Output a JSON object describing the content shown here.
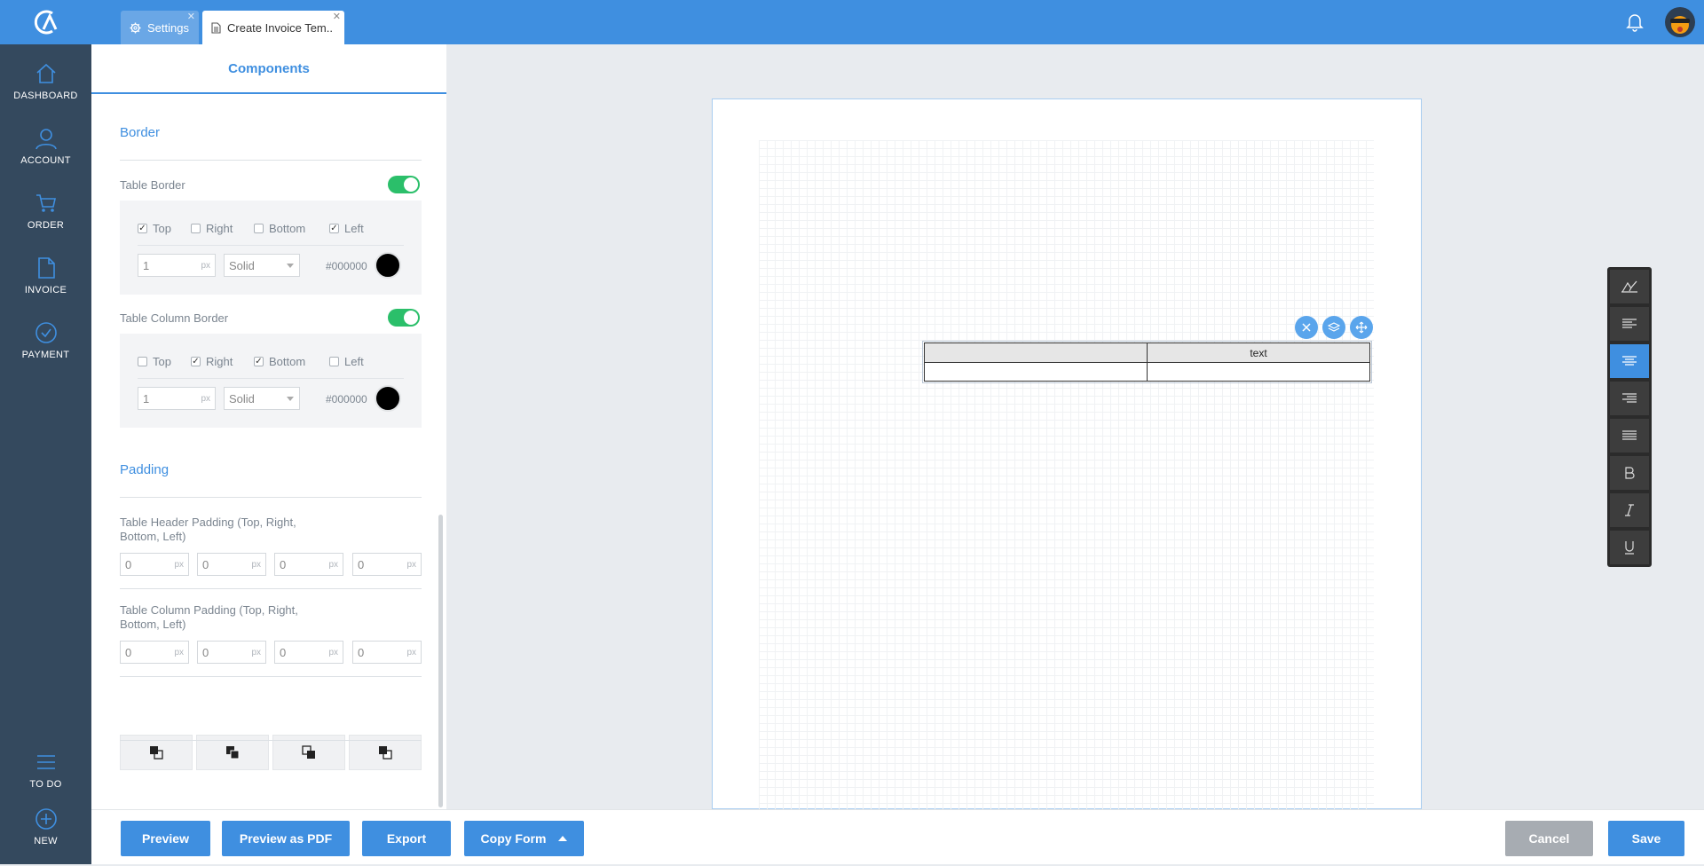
{
  "tabs": [
    {
      "label": "Settings",
      "icon": "gear-icon"
    },
    {
      "label": "Create Invoice Tem..",
      "icon": "document-icon"
    }
  ],
  "sidebar": {
    "items": [
      {
        "label": "DASHBOARD",
        "icon": "home-icon"
      },
      {
        "label": "ACCOUNT",
        "icon": "user-icon"
      },
      {
        "label": "ORDER",
        "icon": "cart-icon"
      },
      {
        "label": "INVOICE",
        "icon": "file-icon"
      },
      {
        "label": "PAYMENT",
        "icon": "check-circle-icon"
      }
    ],
    "bottom_items": [
      {
        "label": "TO DO",
        "icon": "list-icon"
      },
      {
        "label": "NEW",
        "icon": "plus-circle-icon"
      }
    ]
  },
  "panel": {
    "title": "Components",
    "border": {
      "section_title": "Border",
      "table_border": {
        "label": "Table Border",
        "enabled": true,
        "sides": [
          {
            "label": "Top",
            "checked": true
          },
          {
            "label": "Right",
            "checked": false
          },
          {
            "label": "Bottom",
            "checked": false
          },
          {
            "label": "Left",
            "checked": true
          }
        ],
        "width": "1",
        "unit": "px",
        "style": "Solid",
        "color_hex": "#000000"
      },
      "table_column_border": {
        "label": "Table Column Border",
        "enabled": true,
        "sides": [
          {
            "label": "Top",
            "checked": false
          },
          {
            "label": "Right",
            "checked": true
          },
          {
            "label": "Bottom",
            "checked": true
          },
          {
            "label": "Left",
            "checked": false
          }
        ],
        "width": "1",
        "unit": "px",
        "style": "Solid",
        "color_hex": "#000000"
      }
    },
    "padding": {
      "section_title": "Padding",
      "header_label": "Table Header Padding (Top, Right, Bottom, Left)",
      "header_values": [
        "0",
        "0",
        "0",
        "0"
      ],
      "column_label": "Table Column Padding (Top, Right, Bottom, Left)",
      "column_values": [
        "0",
        "0",
        "0",
        "0"
      ],
      "unit": "px"
    },
    "layer_buttons": [
      "bring-forward-icon",
      "bring-to-front-icon",
      "send-backward-icon",
      "send-to-back-icon"
    ]
  },
  "canvas": {
    "table_header_text": "text",
    "controls": [
      "close-icon",
      "layers-icon",
      "move-icon"
    ]
  },
  "format_toolbar": {
    "buttons": [
      "text-style-icon",
      "align-left-icon",
      "align-center-icon",
      "align-right-icon",
      "align-justify-icon",
      "bold-icon",
      "italic-icon",
      "underline-icon"
    ],
    "active": "align-center-icon"
  },
  "footer": {
    "preview": "Preview",
    "preview_pdf": "Preview as PDF",
    "export": "Export",
    "copy_form": "Copy Form",
    "cancel": "Cancel",
    "save": "Save"
  },
  "colors": {
    "primary": "#3f8fe0",
    "sidebar": "#34495e",
    "toggle_on": "#2bbf6a"
  }
}
